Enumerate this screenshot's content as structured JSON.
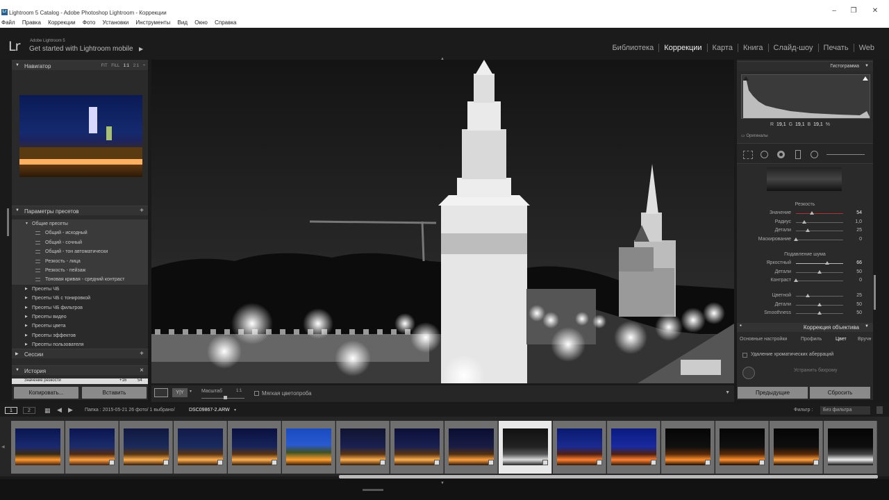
{
  "window": {
    "title": "Lightroom 5 Catalog - Adobe Photoshop Lightroom - Коррекции",
    "app_icon": "Lr"
  },
  "menu": [
    "Файл",
    "Правка",
    "Коррекции",
    "Фото",
    "Установки",
    "Инструменты",
    "Вид",
    "Окно",
    "Справка"
  ],
  "identity": {
    "logo": "Lr",
    "sub": "Adobe Lightroom 5",
    "main": "Get started with Lightroom mobile",
    "arrow": "▶"
  },
  "modules": [
    "Библиотека",
    "Коррекции",
    "Карта",
    "Книга",
    "Слайд-шоу",
    "Печать",
    "Web"
  ],
  "active_module": "Коррекции",
  "navigator": {
    "title": "Навигатор",
    "zoom": [
      "FIT",
      "FILL",
      "1:1",
      "2:1 ÷"
    ]
  },
  "presets": {
    "title": "Параметры пресетов",
    "items": [
      {
        "label": "Общие пресеты",
        "level": 1,
        "open": true
      },
      {
        "label": "Общий - исходный",
        "level": 2
      },
      {
        "label": "Общий - сочный",
        "level": 2
      },
      {
        "label": "Общий - тон автоматически",
        "level": 2
      },
      {
        "label": "Резкость - лица",
        "level": 2
      },
      {
        "label": "Резкость - пейзаж",
        "level": 2
      },
      {
        "label": "Тоновая кривая - средний контраст",
        "level": 2
      },
      {
        "label": "Пресеты ЧБ",
        "level": 0
      },
      {
        "label": "Пресеты ЧБ с тонировкой",
        "level": 0
      },
      {
        "label": "Пресеты ЧБ фильтров",
        "level": 0
      },
      {
        "label": "Пресеты видео",
        "level": 0
      },
      {
        "label": "Пресеты цвета",
        "level": 0
      },
      {
        "label": "Пресеты эффектов",
        "level": 0
      },
      {
        "label": "Пресеты пользователя",
        "level": 0
      }
    ]
  },
  "sessions": {
    "title": "Сессии"
  },
  "history": {
    "title": "История",
    "row_label": "Значение резкости",
    "row_a": "+16",
    "row_b": "54"
  },
  "left_buttons": {
    "copy": "Копировать...",
    "paste": "Вставить"
  },
  "toolbar": {
    "zoom_label": "Масштаб",
    "zoom_val": "1:1",
    "softproof": "Мягкая цветопроба"
  },
  "histogram": {
    "title": "Гистограмма",
    "R": "19,1",
    "G": "19,1",
    "B": "19,1",
    "pct": "%",
    "originals": "Оригиналы"
  },
  "detail": {
    "sharpen_title": "Резкость",
    "sharpen": [
      {
        "label": "Значение",
        "value": "54",
        "pos": 0.34
      },
      {
        "label": "Радиус",
        "value": "1,0",
        "pos": 0.17
      },
      {
        "label": "Детали",
        "value": "25",
        "pos": 0.25
      },
      {
        "label": "Маскирование",
        "value": "0",
        "pos": 0.0
      }
    ],
    "nr_title": "Подавление шума",
    "nr": [
      {
        "label": "Яркостный",
        "value": "66",
        "pos": 0.66
      },
      {
        "label": "Детали",
        "value": "50",
        "pos": 0.5
      },
      {
        "label": "Контраст",
        "value": "0",
        "pos": 0.0
      }
    ],
    "color": [
      {
        "label": "Цветной",
        "value": "25",
        "pos": 0.25
      },
      {
        "label": "Детали",
        "value": "50",
        "pos": 0.5
      },
      {
        "label": "Smoothness",
        "value": "50",
        "pos": 0.5
      }
    ]
  },
  "lens": {
    "title": "Коррекция объектива",
    "tabs": [
      "Основные настройки",
      "Профиль",
      "Цвет",
      "Вручн"
    ],
    "active_tab": "Цвет",
    "chk": "Удаление хроматических аберраций",
    "fringe": "Устранить бахрому"
  },
  "right_buttons": {
    "prev": "Предыдущие",
    "reset": "Сбросить"
  },
  "filmstrip": {
    "pages": [
      "1",
      "2"
    ],
    "path": "Папка : 2015-05-21  26 фото/  1 выбрано/",
    "file": "DSC09867-2.ARW",
    "filter_label": "Фильтр :",
    "filter_value": "Без фильтра",
    "selected_index": 9
  },
  "colors": {
    "accent": "#e8e8e8",
    "panel": "#2a2a2a",
    "selected_cell": "#e8e8e8"
  }
}
